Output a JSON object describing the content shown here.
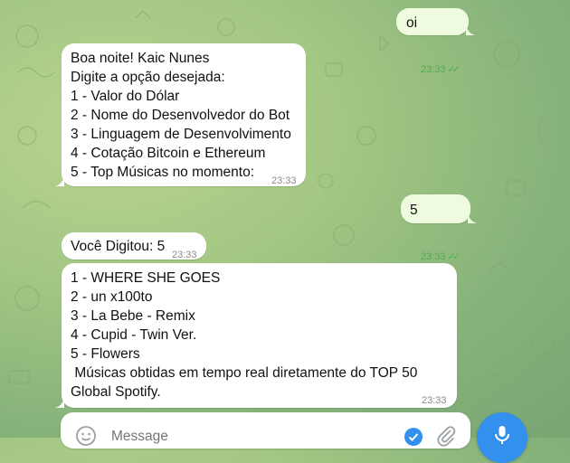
{
  "messages": {
    "m1": {
      "text": "oi",
      "time": "23:33"
    },
    "m2": {
      "text": "Boa noite! Kaic Nunes\nDigite a opção desejada:\n1 - Valor do Dólar\n2 - Nome do Desenvolvedor do Bot\n3 - Linguagem de Desenvolvimento\n4 - Cotação Bitcoin e Ethereum\n5 - Top Músicas no momento:",
      "time": "23:33"
    },
    "m3": {
      "text": "5",
      "time": "23:33"
    },
    "m4": {
      "text": "Você Digitou: 5",
      "time": "23:33"
    },
    "m5": {
      "text": "1 - WHERE SHE GOES\n2 - un x100to\n3 - La Bebe - Remix\n4 - Cupid - Twin Ver.\n5 - Flowers\n Músicas obtidas em tempo real diretamente do TOP 50 Global Spotify.",
      "time": "23:33"
    }
  },
  "composer": {
    "placeholder": "Message"
  },
  "icons": {
    "read": "double-check-icon",
    "emoji": "emoji-icon",
    "attach": "paperclip-icon",
    "mic": "microphone-icon",
    "badge": "check-badge-icon"
  },
  "colors": {
    "accent": "#3390ec",
    "outgoing_bubble": "#eefbdf",
    "check_green": "#4fae4e"
  }
}
